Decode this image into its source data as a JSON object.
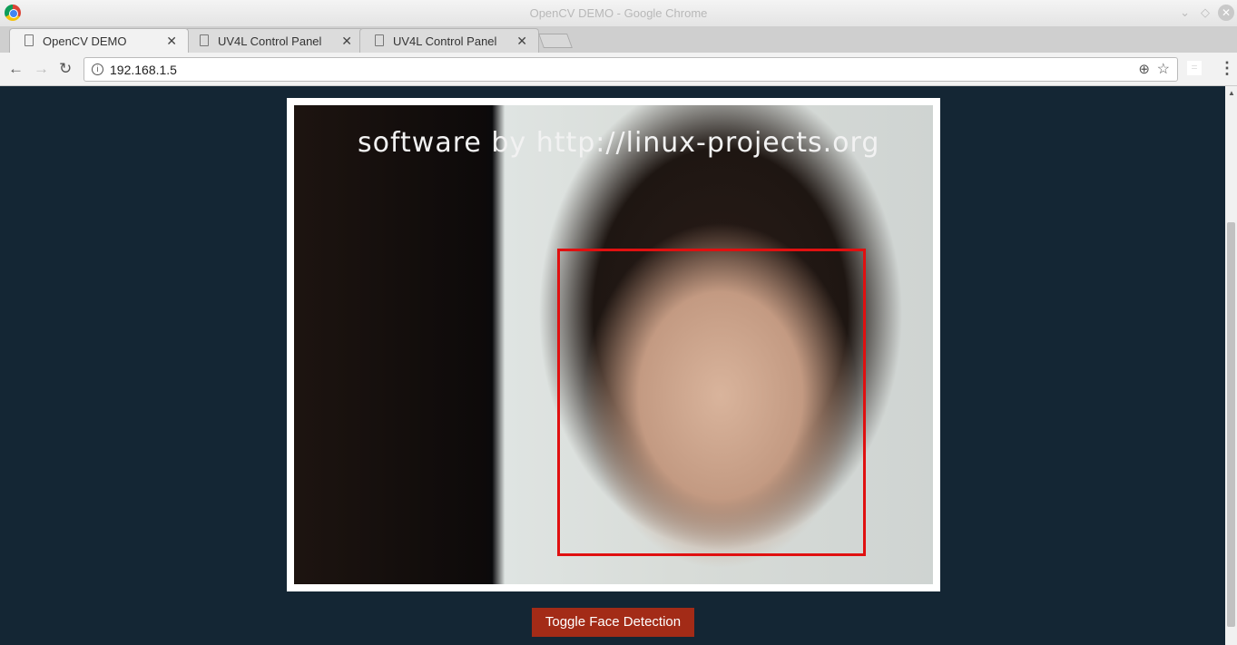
{
  "window": {
    "title": "OpenCV DEMO - Google Chrome"
  },
  "tabs": [
    {
      "label": "OpenCV DEMO",
      "active": true
    },
    {
      "label": "UV4L Control Panel"
    },
    {
      "label": "UV4L Control Panel"
    }
  ],
  "address_bar": {
    "url": "192.168.1.5"
  },
  "video": {
    "watermark": "software by http://linux-projects.org",
    "face_box_color": "#e01010"
  },
  "page": {
    "toggle_button": "Toggle Face Detection",
    "background": "#142634",
    "button_color": "#a32b17"
  }
}
